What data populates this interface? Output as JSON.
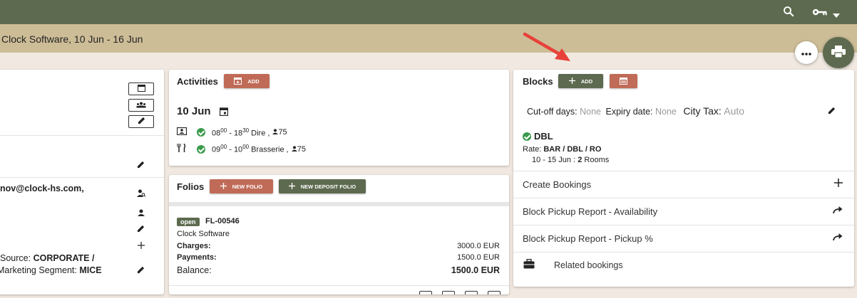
{
  "subheader": {
    "title": "Clock Software, 10 Jun - 16 Jun"
  },
  "icons": [
    "search-icon",
    "key-icon",
    "chevron-down-icon",
    "more-icon",
    "print-icon",
    "calendar-icon",
    "group-icon",
    "pencil-icon",
    "person-search-icon",
    "person-icon",
    "plus-icon",
    "contact-card-icon",
    "check-icon",
    "cutlery-icon",
    "share-icon",
    "briefcase-icon"
  ],
  "colors": {
    "header": "#5d6a4f",
    "subheader": "#cdbd97",
    "accent_red": "#c06b57",
    "accent_green": "#5d6a4f",
    "status_ok": "#3a9b4c",
    "background": "#f1e9e1"
  },
  "left_panel": {
    "email": "nov@clock-hs.com,",
    "source_label": "Source:",
    "source_value": "CORPORATE /",
    "segment_label": "Marketing Segment:",
    "segment_value": "MICE"
  },
  "activities": {
    "title": "Activities",
    "add_label": "ADD",
    "date": "10 Jun",
    "items": [
      {
        "start": "08",
        "start_sup": "00",
        "end": "18",
        "end_sup": "30",
        "place": "Dire ,",
        "count": "75"
      },
      {
        "start": "09",
        "start_sup": "00",
        "end": "10",
        "end_sup": "00",
        "place": "Brasserie ,",
        "count": "75"
      }
    ]
  },
  "folios": {
    "title": "Folios",
    "new_folio_label": "NEW FOLIO",
    "new_deposit_label": "NEW DEPOSIT FOLIO",
    "folio": {
      "status": "open",
      "number": "FL-00546",
      "company": "Clock Software",
      "charges_label": "Charges:",
      "charges_value": "3000.0 EUR",
      "payments_label": "Payments:",
      "payments_value": "1500.0 EUR",
      "balance_label": "Balance:",
      "balance_value": "1500.0 EUR"
    }
  },
  "blocks": {
    "title": "Blocks",
    "add_label": "ADD",
    "cutoff_label": "Cut-off days:",
    "cutoff_value": "None",
    "expiry_label": "Expiry date:",
    "expiry_value": "None",
    "citytax_label": "City Tax:",
    "citytax_value": "Auto",
    "room_type": "DBL",
    "rate_label": "Rate:",
    "rate_value": "BAR / DBL / RO",
    "dates": "10 - 15 Jun :",
    "rooms_count": "2",
    "rooms_label": "Rooms",
    "actions": [
      {
        "label": "Create Bookings"
      },
      {
        "label": "Block Pickup Report - Availability"
      },
      {
        "label": "Block Pickup Report - Pickup %"
      }
    ],
    "related_label": "Related bookings"
  }
}
